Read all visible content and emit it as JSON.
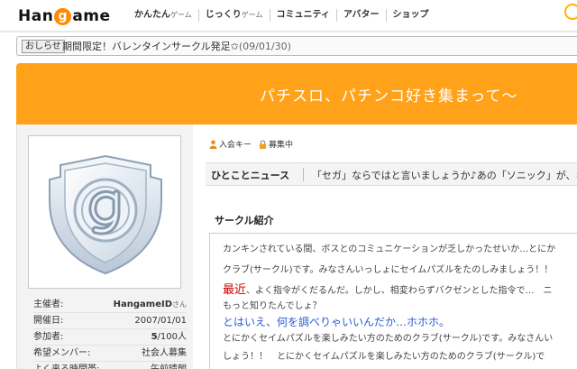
{
  "nav": {
    "logo_pre": "Han",
    "logo_g": "g",
    "logo_post": "ame",
    "links": [
      {
        "label": "かんたん",
        "sub": "ゲーム"
      },
      {
        "label": "じっくり",
        "sub": "ゲーム"
      },
      {
        "label": "コミュニティ",
        "sub": ""
      },
      {
        "label": "アバター",
        "sub": ""
      },
      {
        "label": "ショップ",
        "sub": ""
      }
    ]
  },
  "notice": {
    "tag": "おしらせ",
    "message": "期間限定！バレンタインサークル発足✩",
    "date": "(09/01/30)"
  },
  "banner": {
    "title": "パチスロ、パチンコ好き集まって〜"
  },
  "circle_info": {
    "rows": [
      {
        "key": "主催者:",
        "value": "HangameID",
        "suffix": "さん"
      },
      {
        "key": "開催日:",
        "value": "2007/01/01",
        "suffix": ""
      },
      {
        "key": "参加者:",
        "value": "5",
        "suffix": "/100人"
      },
      {
        "key": "希望メンバー:",
        "value": "社会人募集",
        "suffix": ""
      },
      {
        "key": "よく来る時間帯:",
        "value": "午前晴朝",
        "suffix": ""
      }
    ]
  },
  "tabs": [
    {
      "label": "入会キー",
      "icon": "person-key-icon"
    },
    {
      "label": "募集中",
      "icon": "lock-icon"
    }
  ],
  "news": {
    "label": "ひとことニュース",
    "text": "「セガ」ならではと言いましょうか♪あの「ソニック」が、キャラ"
  },
  "intro": {
    "title": "サークル紹介",
    "lines": [
      "カンキンされている間、ボスとのコミュニケーションが乏しかったせいか…とにか",
      "クラブ(サークル)です。みなさんいっしょにセイムパズルをたのしみましょう！！",
      "、よく指令がくだるんだ。しかし、相変わらずバクゼンとした指令で…　ニ",
      "もっと知りたんでしょ？",
      "とはいえ、何を調べりゃいいんだか…ホホホ。",
      "とにかくセイムパズルを楽しみたい方のためのクラブ(サークル)です。みなさんい",
      "しょう！！　とにかくセイムパズルを楽しみたい方のためのクラブ(サークル)で"
    ],
    "emphasis": "最近"
  },
  "colors": {
    "accent_orange": "#ffa21a",
    "link_blue": "#2a5ad8",
    "emphasis_red": "#c00000"
  }
}
